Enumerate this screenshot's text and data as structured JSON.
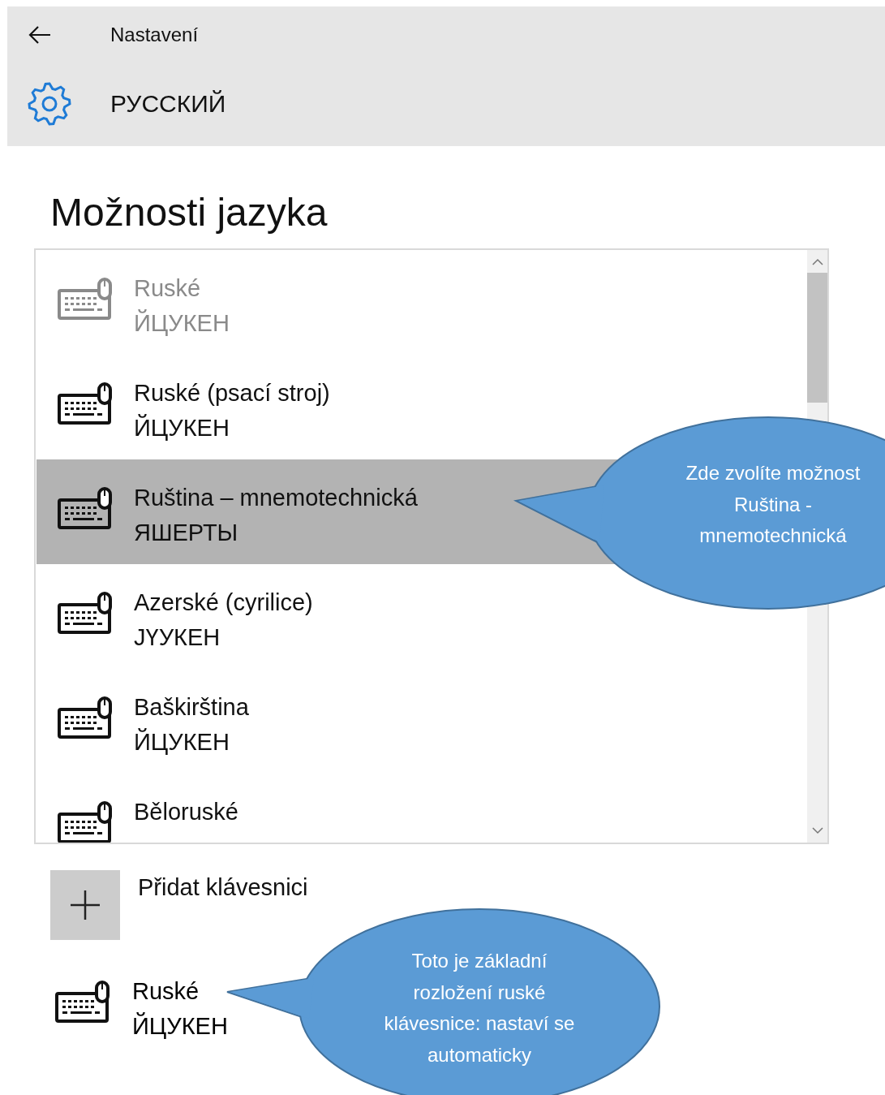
{
  "header": {
    "breadcrumb": "Nastavení",
    "title": "РУССКИЙ"
  },
  "section": {
    "title": "Možnosti jazyka"
  },
  "keyboards": [
    {
      "name": "Ruské",
      "layout": "ЙЦУКЕН",
      "disabled": true,
      "selected": false
    },
    {
      "name": "Ruské (psací stroj)",
      "layout": "ЙЦУКЕН",
      "disabled": false,
      "selected": false
    },
    {
      "name": "Ruština – mnemotechnická",
      "layout": "ЯШЕРТЫ",
      "disabled": false,
      "selected": true
    },
    {
      "name": "Azerské (cyrilice)",
      "layout": "ЈҮУКЕН",
      "disabled": false,
      "selected": false
    },
    {
      "name": "Baškirština",
      "layout": "ЙЦУКЕН",
      "disabled": false,
      "selected": false
    },
    {
      "name": "Běloruské",
      "disabled": false,
      "selected": false
    }
  ],
  "add_keyboard": {
    "label": "Přidat klávesnici"
  },
  "default_keyboard": {
    "name": "Ruské",
    "layout": "ЙЦУКЕН"
  },
  "callouts": [
    {
      "text": "Zde zvolíte možnost\nRuština -\nmnemotechnická"
    },
    {
      "text": "Toto je základní\nrozložení ruské\nklávesnice: nastaví se\nautomaticky"
    }
  ]
}
